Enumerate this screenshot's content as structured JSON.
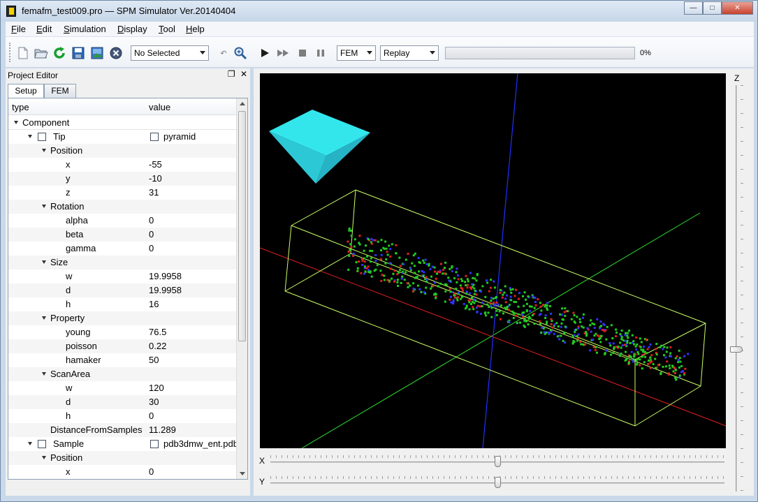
{
  "window": {
    "title": "femafm_test009.pro — SPM Simulator Ver.20140404",
    "controls": [
      "minimize",
      "maximize",
      "close"
    ]
  },
  "menu": [
    "File",
    "Edit",
    "Simulation",
    "Display",
    "Tool",
    "Help"
  ],
  "toolbar": {
    "selection_select": "No Selected",
    "mode_select": "FEM",
    "replay_select": "Replay",
    "progress_value": 0,
    "progress_label": "0%",
    "icons": [
      "new-file-icon",
      "open-folder-icon",
      "reload-icon",
      "save-icon",
      "image-icon",
      "close-circle-icon",
      "undo-icon",
      "zoom-icon",
      "play-icon",
      "fast-forward-icon",
      "stop-icon",
      "pause-icon"
    ]
  },
  "project_editor": {
    "title": "Project Editor",
    "tabs": [
      "Setup",
      "FEM"
    ],
    "active_tab": "Setup",
    "columns": [
      "type",
      "value"
    ],
    "rows": [
      {
        "label": "Component",
        "value": "",
        "level": 0,
        "expanded": true,
        "icon": false
      },
      {
        "label": "Tip",
        "value": "pyramid",
        "level": 1,
        "expanded": true,
        "icon": true
      },
      {
        "label": "Position",
        "value": "",
        "level": 2,
        "expanded": true,
        "icon": false
      },
      {
        "label": "x",
        "value": "-55",
        "level": 3,
        "icon": false
      },
      {
        "label": "y",
        "value": "-10",
        "level": 3,
        "icon": false
      },
      {
        "label": "z",
        "value": "31",
        "level": 3,
        "icon": false
      },
      {
        "label": "Rotation",
        "value": "",
        "level": 2,
        "expanded": true,
        "icon": false
      },
      {
        "label": "alpha",
        "value": "0",
        "level": 3,
        "icon": false
      },
      {
        "label": "beta",
        "value": "0",
        "level": 3,
        "icon": false
      },
      {
        "label": "gamma",
        "value": "0",
        "level": 3,
        "icon": false
      },
      {
        "label": "Size",
        "value": "",
        "level": 2,
        "expanded": true,
        "icon": false
      },
      {
        "label": "w",
        "value": "19.9958",
        "level": 3,
        "icon": false
      },
      {
        "label": "d",
        "value": "19.9958",
        "level": 3,
        "icon": false
      },
      {
        "label": "h",
        "value": "16",
        "level": 3,
        "icon": false
      },
      {
        "label": "Property",
        "value": "",
        "level": 2,
        "expanded": true,
        "icon": false
      },
      {
        "label": "young",
        "value": "76.5",
        "level": 3,
        "icon": false
      },
      {
        "label": "poisson",
        "value": "0.22",
        "level": 3,
        "icon": false
      },
      {
        "label": "hamaker",
        "value": "50",
        "level": 3,
        "icon": false
      },
      {
        "label": "ScanArea",
        "value": "",
        "level": 2,
        "expanded": true,
        "icon": false
      },
      {
        "label": "w",
        "value": "120",
        "level": 3,
        "icon": false
      },
      {
        "label": "d",
        "value": "30",
        "level": 3,
        "icon": false
      },
      {
        "label": "h",
        "value": "0",
        "level": 3,
        "icon": false
      },
      {
        "label": "DistanceFromSamples",
        "value": "11.289",
        "level": 2,
        "icon": false
      },
      {
        "label": "Sample",
        "value": "pdb3dmw_ent.pdb",
        "level": 1,
        "expanded": true,
        "icon": true
      },
      {
        "label": "Position",
        "value": "",
        "level": 2,
        "expanded": true,
        "icon": false
      },
      {
        "label": "x",
        "value": "0",
        "level": 3,
        "icon": false
      }
    ]
  },
  "view": {
    "slider_x_label": "X",
    "slider_y_label": "Y",
    "slider_z_label": "Z",
    "slider_x_value": 0.5,
    "slider_y_value": 0.5,
    "slider_z_value": 0.65,
    "colors": {
      "background": "#000000",
      "tip": "#33e6ec",
      "x_axis": "#e02020",
      "y_axis": "#30e030",
      "z_axis": "#2030ff",
      "box": "#ccff66",
      "atom_green": "#22cc22",
      "atom_blue": "#3333ff",
      "atom_red": "#dd2222"
    }
  }
}
